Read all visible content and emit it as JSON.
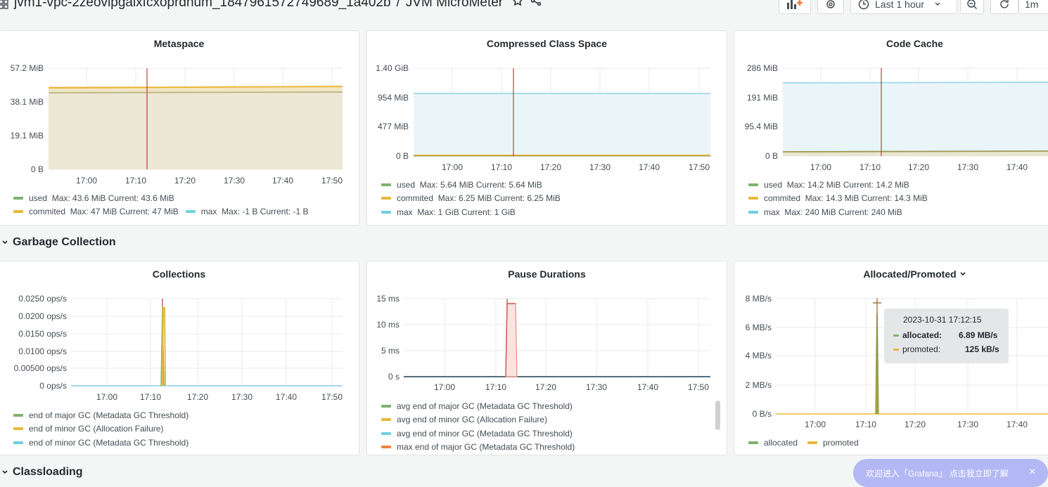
{
  "header": {
    "breadcrumb_folder": "jvm1-vpc-2zeovlpgalxfcxoprdhum_1847961572749689_1a402b",
    "separator": "/",
    "dashboard": "JVM MicroMeter",
    "time_range": "Last 1 hour",
    "refresh": "1m"
  },
  "rows": {
    "gc": "Garbage Collection",
    "classloading": "Classloading"
  },
  "colors": {
    "green": "#7eb26d",
    "yellow": "#eab839",
    "blue": "#6ed0e0",
    "orange": "#ef843c",
    "red": "#bf1b00"
  },
  "panels": {
    "metaspace": {
      "title": "Metaspace",
      "legend": {
        "used": "used",
        "used_stats": "Max: 43.6 MiB  Current: 43.6 MiB",
        "commited": "commited",
        "commited_stats": "Max: 47 MiB  Current: 47 MiB",
        "max": "max",
        "max_stats": "Max: -1 B  Current: -1 B"
      }
    },
    "ccs": {
      "title": "Compressed Class Space",
      "legend": {
        "used": "used",
        "used_stats": "Max: 5.64 MiB  Current: 5.64 MiB",
        "commited": "commited",
        "commited_stats": "Max: 6.25 MiB  Current: 6.25 MiB",
        "max": "max",
        "max_stats": "Max: 1 GiB  Current: 1 GiB"
      }
    },
    "codecache": {
      "title": "Code Cache",
      "legend": {
        "used": "used",
        "used_stats": "Max: 14.2 MiB  Current: 14.2 MiB",
        "commited": "commited",
        "commited_stats": "Max: 14.3 MiB  Current: 14.3 MiB",
        "max": "max",
        "max_stats": "Max: 240 MiB  Current: 240 MiB"
      }
    },
    "collections": {
      "title": "Collections",
      "legend": [
        "end of major GC (Metadata GC Threshold)",
        "end of minor GC (Allocation Failure)",
        "end of minor GC (Metadata GC Threshold)"
      ]
    },
    "pause": {
      "title": "Pause Durations",
      "legend": [
        "avg end of major GC (Metadata GC Threshold)",
        "avg end of minor GC (Allocation Failure)",
        "avg end of minor GC (Metadata GC Threshold)",
        "max end of major GC (Metadata GC Threshold)"
      ]
    },
    "allocated": {
      "title": "Allocated/Promoted",
      "legend": [
        "allocated",
        "promoted"
      ],
      "tooltip": {
        "time": "2023-10-31 17:12:15",
        "allocated_label": "allocated:",
        "allocated_value": "6.89 MB/s",
        "promoted_label": "promoted:",
        "promoted_value": "125 kB/s"
      }
    }
  },
  "banner": {
    "text": "欢迎进入「Grafana」 点击我立即了解",
    "close": "×"
  },
  "chart_data": [
    {
      "id": "metaspace",
      "type": "area",
      "title": "Metaspace",
      "x": [
        "17:00",
        "17:10",
        "17:20",
        "17:30",
        "17:40",
        "17:50"
      ],
      "yticks": [
        "57.2 MiB",
        "38.1 MiB",
        "19.1 MiB",
        "0 B"
      ],
      "ylim_mib": [
        0,
        57.2
      ],
      "series": [
        {
          "name": "used",
          "values_mib": [
            43.6,
            43.6,
            43.6,
            43.6,
            43.6,
            43.6
          ]
        },
        {
          "name": "commited",
          "values_mib": [
            47,
            47,
            47,
            47,
            47,
            47
          ]
        },
        {
          "name": "max",
          "values_mib": [
            0,
            0,
            0,
            0,
            0,
            0
          ]
        }
      ],
      "annotation": "17:11"
    },
    {
      "id": "ccs",
      "type": "area",
      "title": "Compressed Class Space",
      "x": [
        "17:00",
        "17:10",
        "17:20",
        "17:30",
        "17:40",
        "17:50"
      ],
      "yticks": [
        "1.40 GiB",
        "954 MiB",
        "477 MiB",
        "0 B"
      ],
      "ylim_mib": [
        0,
        1430
      ],
      "series": [
        {
          "name": "used",
          "values_mib": [
            5.64,
            5.64,
            5.64,
            5.64,
            5.64,
            5.64
          ]
        },
        {
          "name": "commited",
          "values_mib": [
            6.25,
            6.25,
            6.25,
            6.25,
            6.25,
            6.25
          ]
        },
        {
          "name": "max",
          "values_mib": [
            1024,
            1024,
            1024,
            1024,
            1024,
            1024
          ]
        }
      ],
      "annotation": "17:11"
    },
    {
      "id": "codecache",
      "type": "area",
      "title": "Code Cache",
      "x": [
        "17:00",
        "17:10",
        "17:20",
        "17:30",
        "17:40"
      ],
      "yticks": [
        "286 MiB",
        "191 MiB",
        "95.4 MiB",
        "0 B"
      ],
      "ylim_mib": [
        0,
        286
      ],
      "series": [
        {
          "name": "used",
          "values_mib": [
            14.2,
            14.2,
            14.2,
            14.2,
            14.2
          ]
        },
        {
          "name": "commited",
          "values_mib": [
            14.3,
            14.3,
            14.3,
            14.3,
            14.3
          ]
        },
        {
          "name": "max",
          "values_mib": [
            240,
            240,
            240,
            240,
            240
          ]
        }
      ],
      "annotation": "17:11"
    },
    {
      "id": "collections",
      "type": "line",
      "title": "Collections",
      "x": [
        "17:00",
        "17:10",
        "17:20",
        "17:30",
        "17:40",
        "17:50"
      ],
      "yticks": [
        "0.0250 ops/s",
        "0.0200 ops/s",
        "0.0150 ops/s",
        "0.0100 ops/s",
        "0.00500 ops/s",
        "0 ops/s"
      ],
      "ylim": [
        0,
        0.025
      ],
      "series": [
        {
          "name": "end of major GC (Metadata GC Threshold)",
          "peak_at": "17:12",
          "peak": 0.0222
        },
        {
          "name": "end of minor GC (Allocation Failure)",
          "peak_at": "17:12",
          "peak": 0.0222
        },
        {
          "name": "end of minor GC (Metadata GC Threshold)",
          "peak_at": "17:12",
          "peak": 0
        }
      ],
      "annotation": "17:11"
    },
    {
      "id": "pause",
      "type": "line",
      "title": "Pause Durations",
      "x": [
        "17:00",
        "17:10",
        "17:20",
        "17:30",
        "17:40",
        "17:50"
      ],
      "yticks": [
        "15 ms",
        "10 ms",
        "5 ms",
        "0 s"
      ],
      "ylim_ms": [
        0,
        15
      ],
      "series": [
        {
          "name": "avg end of major GC (Metadata GC Threshold)",
          "peak_ms": 14
        },
        {
          "name": "avg end of minor GC (Allocation Failure)",
          "peak_ms": 14
        },
        {
          "name": "avg end of minor GC (Metadata GC Threshold)",
          "peak_ms": 0
        },
        {
          "name": "max end of major GC (Metadata GC Threshold)",
          "peak_ms": 14
        }
      ],
      "annotation": "17:11"
    },
    {
      "id": "allocated",
      "type": "line",
      "title": "Allocated/Promoted",
      "x": [
        "17:00",
        "17:10",
        "17:20",
        "17:30",
        "17:40"
      ],
      "yticks": [
        "8 MB/s",
        "6 MB/s",
        "4 MB/s",
        "2 MB/s",
        "0 B/s"
      ],
      "ylim_mbs": [
        0,
        8
      ],
      "series": [
        {
          "name": "allocated",
          "peak_at": "2023-10-31 17:12:15",
          "peak_mbs": 6.89
        },
        {
          "name": "promoted",
          "peak_at": "2023-10-31 17:12:15",
          "peak_mbs": 0.125
        }
      ]
    }
  ]
}
